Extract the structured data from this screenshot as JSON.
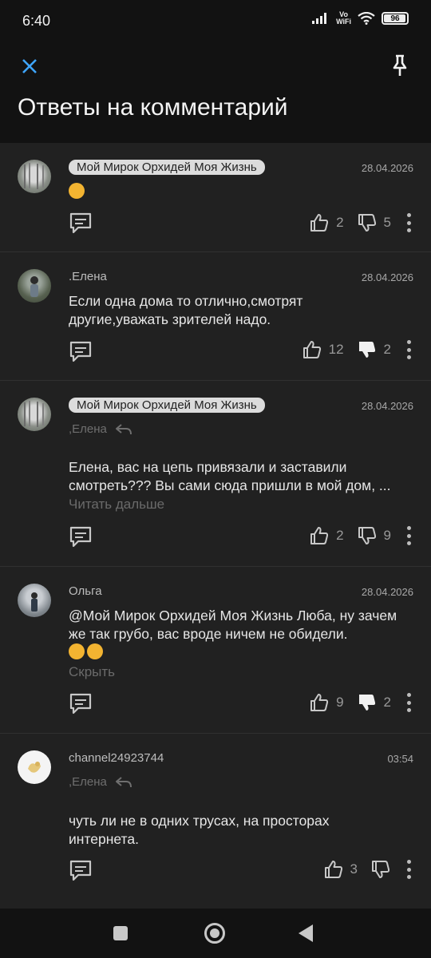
{
  "status": {
    "time": "6:40",
    "vo": "Vo",
    "wifi_label": "WiFi",
    "battery": "96",
    "battery_level": 0.96
  },
  "header": {
    "title": "Ответы на комментарий"
  },
  "comments": [
    {
      "author": "Мой Мирок Орхидей Моя Жизнь",
      "date": "28.04.2026",
      "text": "",
      "likes": "2",
      "dislikes": "5"
    },
    {
      "author": ".Елена",
      "date": "28.04.2026",
      "text": "Если одна дома то отлично,смотрят другие,уважать зрителей надо.",
      "likes": "12",
      "dislikes": "2"
    },
    {
      "author": "Мой Мирок Орхидей Моя Жизнь",
      "reply_to": ",Елена",
      "date": "28.04.2026",
      "text": "Елена, вас на цепь привязали и заставили смотреть??? Вы сами сюда пришли в мой дом, ...",
      "more": "Читать дальше",
      "likes": "2",
      "dislikes": "9"
    },
    {
      "author": "Ольга",
      "date": "28.04.2026",
      "text": "@Мой Мирок Орхидей Моя Жизнь Люба, ну зачем же так грубо, вас вроде ничем не обидели.",
      "more": "Скрыть",
      "likes": "9",
      "dislikes": "2"
    },
    {
      "author": "channel24923744",
      "reply_to": ",Елена",
      "date": "03:54",
      "text": "чуть ли не в одних трусах, на просторах интернета.",
      "likes": "3",
      "dislikes": ""
    }
  ],
  "icons": {
    "close": "close-icon",
    "pin": "pin-icon",
    "reply": "comment-reply-icon",
    "like": "thumb-up-icon",
    "dislike": "thumb-down-icon",
    "more": "more-vertical-icon"
  },
  "colors": {
    "background": "#212121",
    "bar": "#121212",
    "accent": "#3ea6ff"
  }
}
